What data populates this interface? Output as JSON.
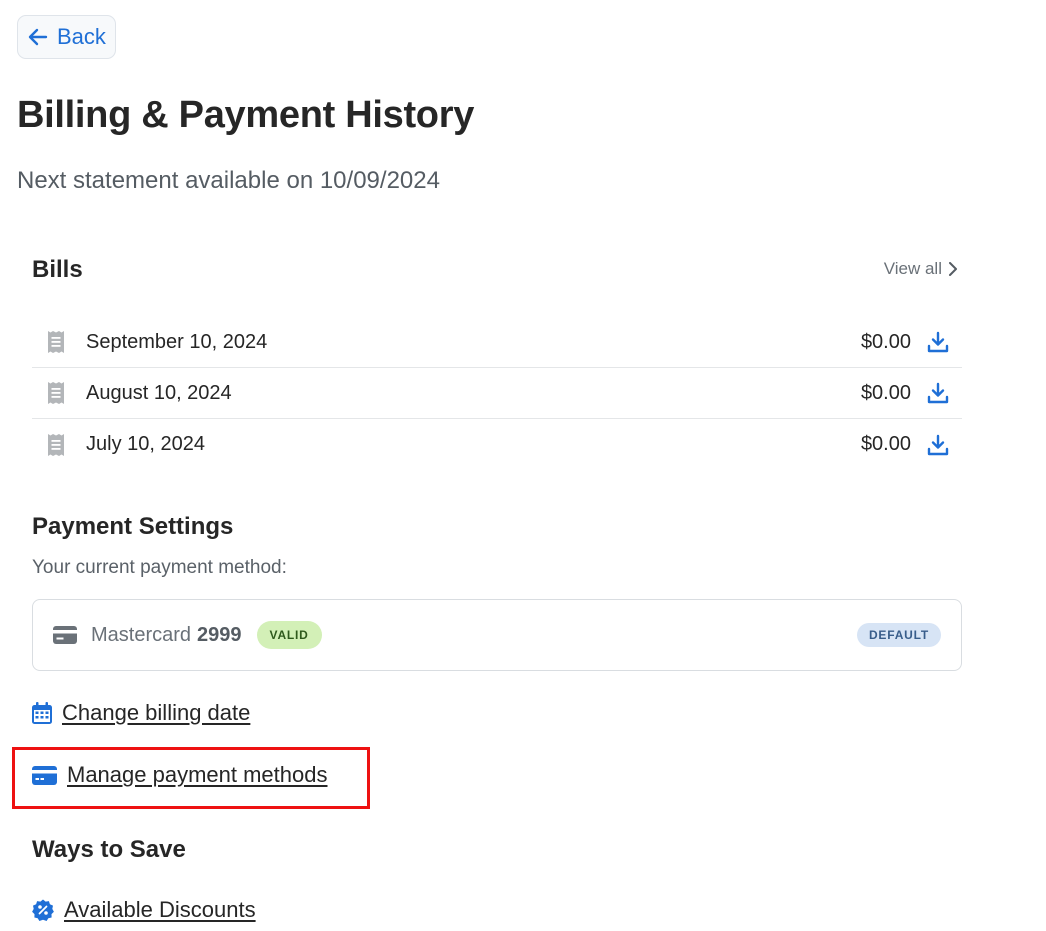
{
  "header": {
    "back_label": "Back",
    "title": "Billing & Payment History",
    "subtitle": "Next statement available on 10/09/2024"
  },
  "bills": {
    "title": "Bills",
    "view_all_label": "View all",
    "items": [
      {
        "date": "September 10, 2024",
        "amount": "$0.00"
      },
      {
        "date": "August 10, 2024",
        "amount": "$0.00"
      },
      {
        "date": "July 10, 2024",
        "amount": "$0.00"
      }
    ]
  },
  "payment_settings": {
    "title": "Payment Settings",
    "current_label": "Your current payment method:",
    "card": {
      "brand": "Mastercard",
      "last4": "2999",
      "status": "VALID",
      "tag": "DEFAULT"
    },
    "links": [
      {
        "label": "Change billing date",
        "icon": "calendar-icon"
      },
      {
        "label": "Manage payment methods",
        "icon": "credit-card-icon"
      }
    ]
  },
  "ways_to_save": {
    "title": "Ways to Save",
    "links": [
      {
        "label": "Available Discounts",
        "icon": "discount-badge-icon"
      }
    ]
  },
  "colors": {
    "accent_blue": "#1f6fd6",
    "valid_green": "#d3f0b7",
    "default_blue": "#d7e4f5",
    "highlight_red": "#ee1111"
  }
}
